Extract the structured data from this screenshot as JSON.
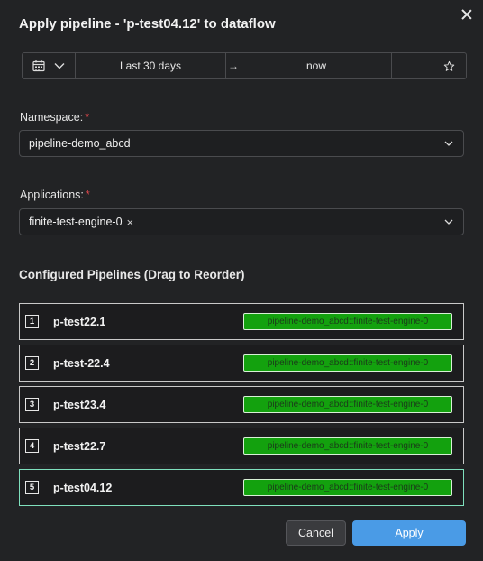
{
  "dialog": {
    "title": "Apply pipeline - 'p-test04.12' to dataflow"
  },
  "time_range": {
    "from": "Last 30 days",
    "arrow": "→",
    "to": "now"
  },
  "namespace": {
    "label": "Namespace:",
    "required_mark": "*",
    "value": "pipeline-demo_abcd"
  },
  "applications": {
    "label": "Applications:",
    "required_mark": "*",
    "selected_tag": "finite-test-engine-0",
    "remove_glyph": "×"
  },
  "pipelines": {
    "heading": "Configured Pipelines (Drag to Reorder)",
    "rows": [
      {
        "num": "1",
        "name": "p-test22.1",
        "target": "pipeline-demo_abcd::finite-test-engine-0"
      },
      {
        "num": "2",
        "name": "p-test-22.4",
        "target": "pipeline-demo_abcd::finite-test-engine-0"
      },
      {
        "num": "3",
        "name": "p-test23.4",
        "target": "pipeline-demo_abcd::finite-test-engine-0"
      },
      {
        "num": "4",
        "name": "p-test22.7",
        "target": "pipeline-demo_abcd::finite-test-engine-0"
      },
      {
        "num": "5",
        "name": "p-test04.12",
        "target": "pipeline-demo_abcd::finite-test-engine-0"
      }
    ]
  },
  "footer": {
    "cancel_label": "Cancel",
    "apply_label": "Apply"
  },
  "colors": {
    "background": "#222325",
    "badge_green": "#13a10e",
    "apply_blue": "#4a9be6",
    "active_row_border": "#7fe0bd",
    "required_red": "#e5484d"
  },
  "icons": [
    "calendar-icon",
    "chevron-down-icon",
    "arrow-right-icon",
    "star-icon",
    "close-icon"
  ]
}
